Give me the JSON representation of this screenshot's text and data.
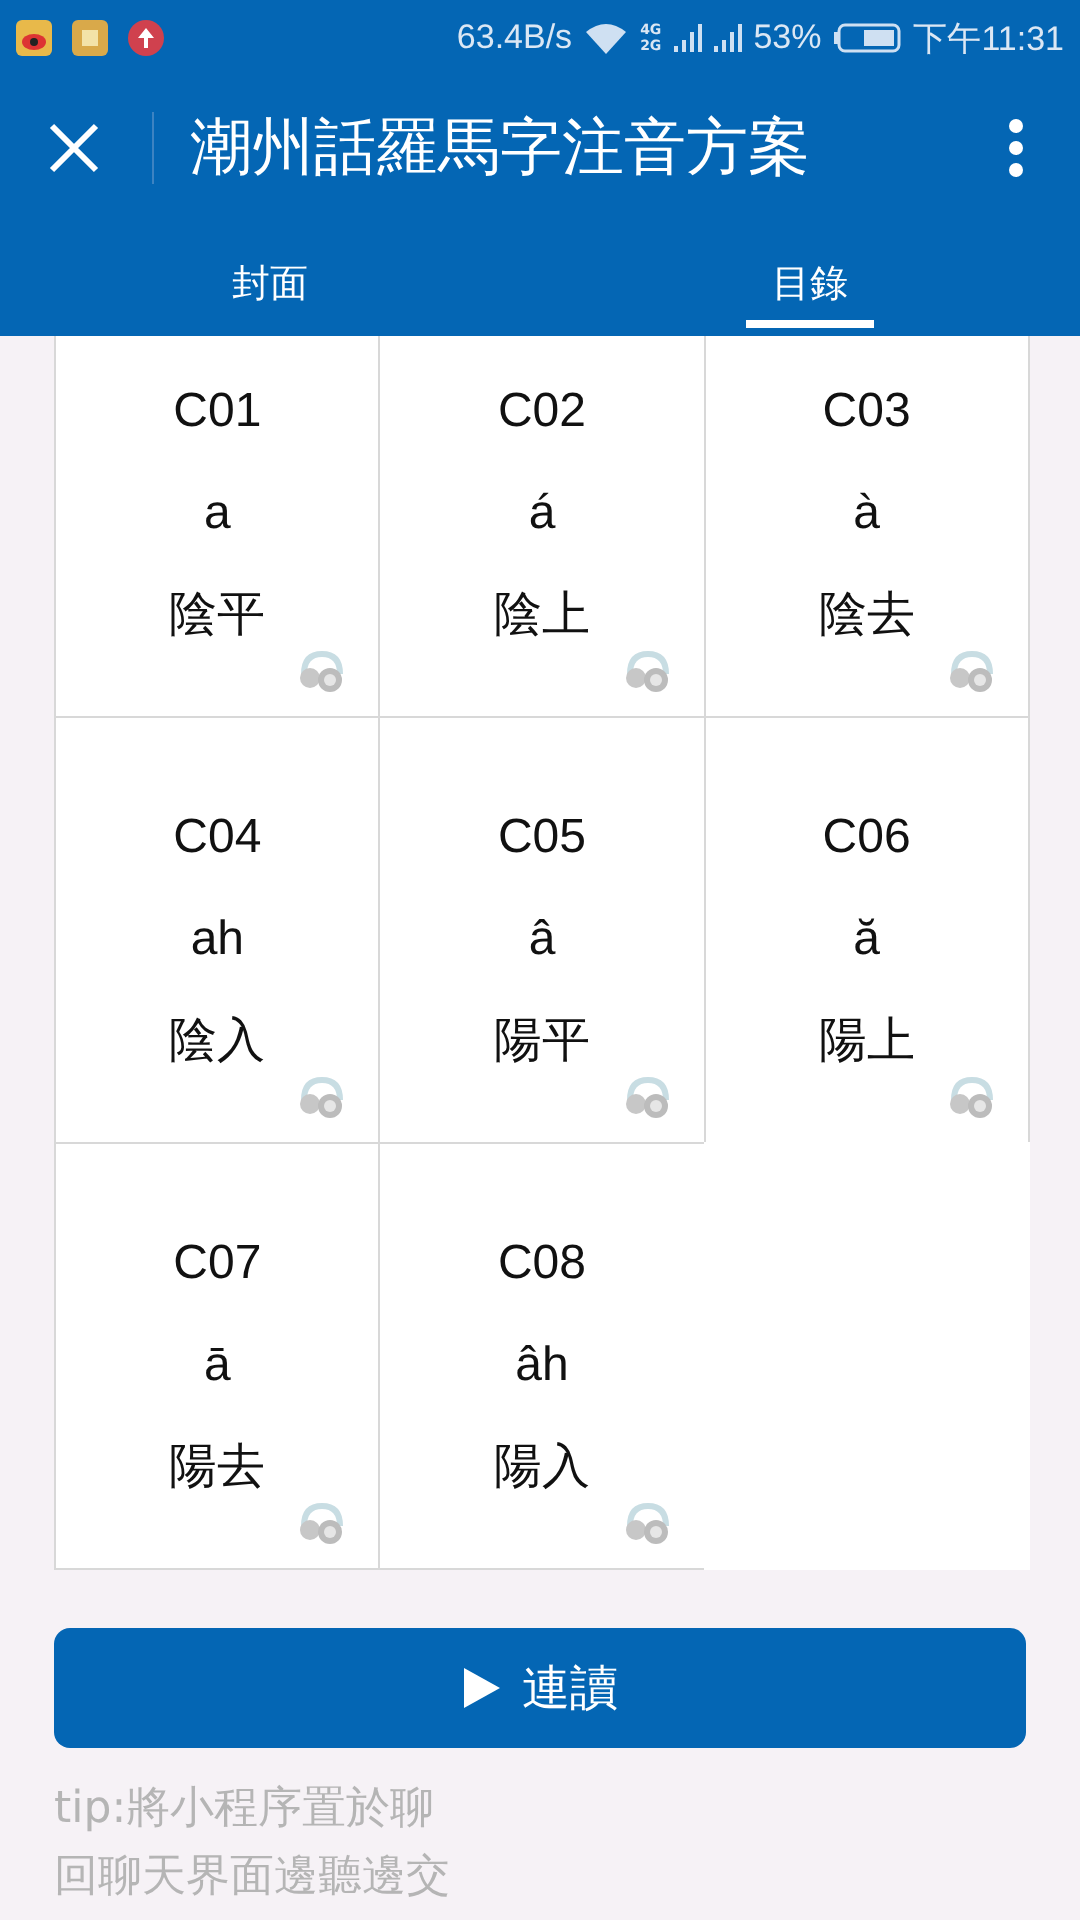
{
  "status_bar": {
    "speed": "63.4B/s",
    "network_labels": [
      "4G",
      "2G"
    ],
    "battery_percent": "53%",
    "time": "下午11:31"
  },
  "header": {
    "title": "潮州話羅馬字注音方案"
  },
  "tabs": [
    {
      "label": "封面",
      "selected": false
    },
    {
      "label": "目錄",
      "selected": true
    }
  ],
  "tones": [
    {
      "code": "C01",
      "spelling": "a",
      "name": "陰平"
    },
    {
      "code": "C02",
      "spelling": "á",
      "name": "陰上"
    },
    {
      "code": "C03",
      "spelling": "à",
      "name": "陰去"
    },
    {
      "code": "C04",
      "spelling": "ah",
      "name": "陰入"
    },
    {
      "code": "C05",
      "spelling": "â",
      "name": "陽平"
    },
    {
      "code": "C06",
      "spelling": "ă",
      "name": "陽上"
    },
    {
      "code": "C07",
      "spelling": "ā",
      "name": "陽去"
    },
    {
      "code": "C08",
      "spelling": "âh",
      "name": "陽入"
    }
  ],
  "play_button": {
    "label": "連讀"
  },
  "tip_lines": [
    "tip:將小程序置於聊",
    "回聊天界面邊聽邊交"
  ]
}
